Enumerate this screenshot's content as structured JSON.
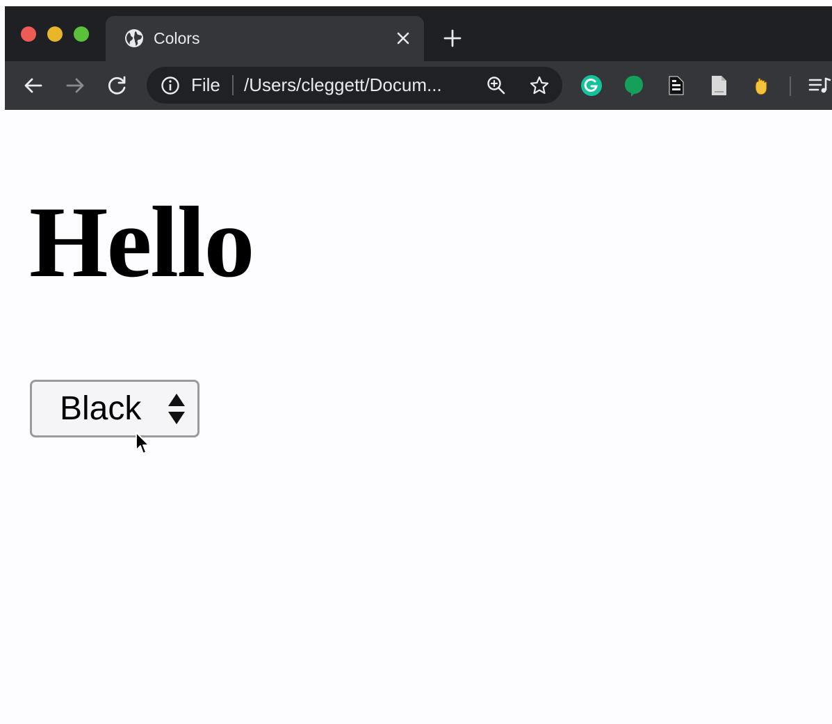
{
  "browser": {
    "tab": {
      "title": "Colors",
      "favicon": "globe-icon"
    },
    "toolbar": {
      "back_icon": "back-arrow-icon",
      "forward_icon": "forward-arrow-icon",
      "reload_icon": "reload-icon",
      "address": {
        "scheme_label": "File",
        "url": "/Users/cleggett/Docum..."
      },
      "extensions": [
        "grammarly-icon",
        "evernote-icon",
        "document-icon",
        "page-icon",
        "hand-icon",
        "reading-list-icon"
      ]
    }
  },
  "page": {
    "heading": "Hello",
    "color_select": {
      "selected": "Black"
    }
  },
  "colors": {
    "tabstrip_bg": "#1f2024",
    "toolbar_bg": "#35363a",
    "page_bg": "#fdfcfe",
    "traffic_red": "#ed5b55",
    "traffic_yellow": "#e8b52b",
    "traffic_green": "#5ac23a"
  }
}
